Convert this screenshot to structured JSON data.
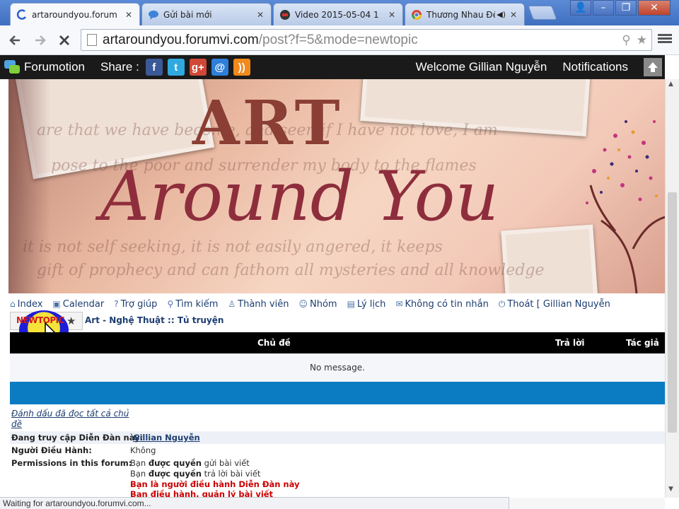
{
  "browser": {
    "tabs": [
      {
        "label": "artaroundyou.forum",
        "active": true
      },
      {
        "label": "Gửi bài mới",
        "active": false
      },
      {
        "label": "Video 2015-05-04 1",
        "active": false
      },
      {
        "label": "Thương Nhau Đề",
        "active": false
      }
    ],
    "window_buttons": {
      "user": "👤",
      "minimize": "–",
      "restore": "❐",
      "close": "✕"
    },
    "url_host": "artaroundyou.forumvi.com",
    "url_rest": "/post?f=5&mode=newtopic",
    "status": "Waiting for artaroundyou.forumvi.com..."
  },
  "forumotion_bar": {
    "brand": "Forumotion",
    "share_label": "Share :",
    "share_icons": [
      {
        "icon": "facebook-icon",
        "glyph": "f",
        "color": "#3b5998"
      },
      {
        "icon": "twitter-icon",
        "glyph": "t",
        "color": "#2fa9e0"
      },
      {
        "icon": "google-plus-icon",
        "glyph": "g+",
        "color": "#d14836"
      },
      {
        "icon": "email-icon",
        "glyph": "@",
        "color": "#2e7fd9"
      },
      {
        "icon": "rss-icon",
        "glyph": "))",
        "color": "#f08a1c"
      }
    ],
    "welcome": "Welcome Gillian Nguyễn",
    "notifications": "Notifications"
  },
  "banner": {
    "title_art": "ART",
    "title_around": "Around You"
  },
  "forum_nav": [
    {
      "icon": "home-icon",
      "glyph": "⌂",
      "label": "Index"
    },
    {
      "icon": "calendar-icon",
      "glyph": "▣",
      "label": "Calendar"
    },
    {
      "icon": "help-icon",
      "glyph": "?",
      "label": "Trợ giúp"
    },
    {
      "icon": "search-icon",
      "glyph": "⚲",
      "label": "Tìm kiếm"
    },
    {
      "icon": "member-icon",
      "glyph": "♙",
      "label": "Thành viên"
    },
    {
      "icon": "group-icon",
      "glyph": "☺",
      "label": "Nhóm"
    },
    {
      "icon": "profile-icon",
      "glyph": "▤",
      "label": "Lý lịch"
    },
    {
      "icon": "message-icon",
      "glyph": "✉",
      "label": "Không có tin nhắn"
    },
    {
      "icon": "logout-icon",
      "glyph": "⏻",
      "label": "Thoát [ Gillian Nguyễn"
    }
  ],
  "newtopic_label": "NEWTOPIC",
  "breadcrumb": "Art - Nghệ Thuật :: Tủ truyện",
  "table": {
    "headers": {
      "topic": "Chủ đề",
      "replies": "Trả lời",
      "author": "Tác giả"
    },
    "empty_message": "No message."
  },
  "mark_read": "Đánh dấu đã đọc tất cả chủ đề",
  "info": {
    "browsing_label": "Đang truy cập Diễn Đàn này:",
    "browsing_user": "Gillian Nguyễn",
    "moderator_label": "Người Điều Hành:",
    "moderator_value": "Không",
    "permissions_label": "Permissions in this forum:",
    "perm1_pre": "Bạn ",
    "perm1_bold": "được quyền",
    "perm1_post": " gửi bài viết",
    "perm2_pre": "Bạn ",
    "perm2_bold": "được quyền",
    "perm2_post": " trả lời bài viết",
    "perm3": "Bạn là người điều hành Diễn Đàn này",
    "perm4": "Bạn điều hành, quản lý bài viết"
  }
}
